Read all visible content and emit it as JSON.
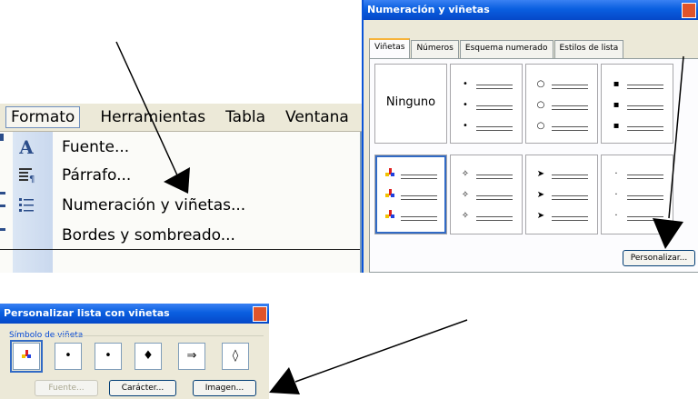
{
  "menu": {
    "bar": [
      "Formato",
      "Herramientas",
      "Tabla",
      "Ventana"
    ],
    "items": [
      {
        "label": "Fuente...",
        "icon": "font-A-icon"
      },
      {
        "label": "Párrafo...",
        "icon": "paragraph-icon"
      },
      {
        "label": "Numeración y viñetas...",
        "icon": "bullet-list-icon"
      },
      {
        "label": "Bordes y sombreado...",
        "icon": ""
      }
    ]
  },
  "dialog1": {
    "title": "Numeración y viñetas",
    "tabs": [
      "Viñetas",
      "Números",
      "Esquema numerado",
      "Estilos de lista"
    ],
    "none_label": "Ninguno",
    "bullet_symbols": [
      "•",
      "○",
      "▪",
      "✧",
      "➤",
      "·"
    ],
    "button": "Personalizar..."
  },
  "dialog2": {
    "title": "Personalizar lista con viñetas",
    "group_label": "Símbolo de viñeta",
    "symbols": [
      "•",
      "•",
      "♦",
      "⇒",
      "◊"
    ],
    "buttons": [
      "Fuente...",
      "Carácter...",
      "Imagen..."
    ]
  },
  "colors": {
    "titlebar": "#0a5fe0",
    "selection": "#316ac5",
    "dialog_bg": "#ece9d8"
  }
}
